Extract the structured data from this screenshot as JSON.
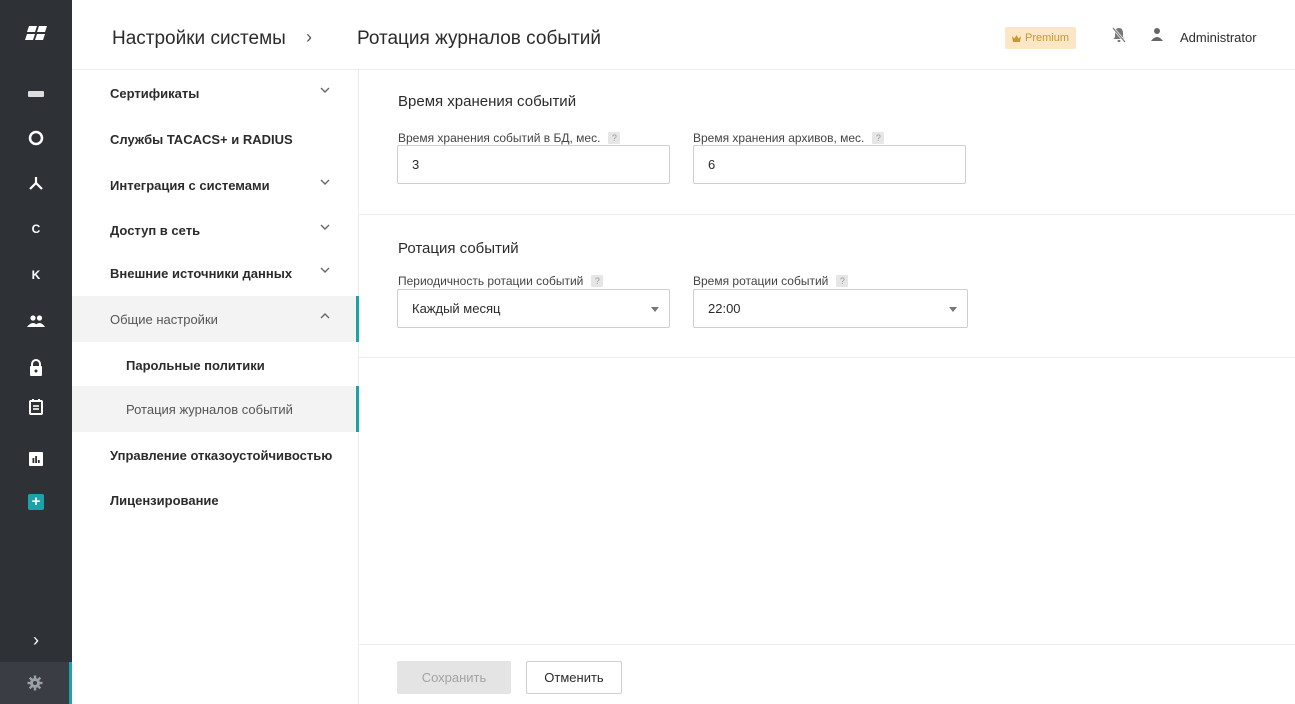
{
  "header": {
    "breadcrumb_root": "Настройки системы",
    "breadcrumb_sep": "›",
    "breadcrumb_current": "Ротация журналов событий",
    "premium_label": "Premium",
    "user_name": "Administrator"
  },
  "rail": {
    "items": [
      {
        "icon": "server-icon"
      },
      {
        "icon": "circle-icon"
      },
      {
        "icon": "network-icon"
      },
      {
        "icon": "letter-c-icon",
        "label": "C"
      },
      {
        "icon": "letter-k-icon",
        "label": "K"
      },
      {
        "icon": "users-icon"
      },
      {
        "icon": "lock-icon"
      },
      {
        "icon": "calendar-icon"
      },
      {
        "icon": "chart-icon"
      },
      {
        "icon": "plus-icon"
      },
      {
        "icon": "expand-icon",
        "label": "›"
      },
      {
        "icon": "gear-icon"
      }
    ]
  },
  "submenu": {
    "items": [
      {
        "label": "Сертификаты",
        "expandable": true
      },
      {
        "label": "Службы TACACS+ и RADIUS",
        "expandable": false
      },
      {
        "label": "Интеграция с системами",
        "expandable": true
      },
      {
        "label": "Доступ в сеть",
        "expandable": true
      },
      {
        "label": "Внешние источники данных",
        "expandable": true
      },
      {
        "label": "Общие настройки",
        "expandable": true,
        "expanded": true
      },
      {
        "label": "Парольные политики",
        "child": true
      },
      {
        "label": "Ротация журналов событий",
        "child": true,
        "active": true
      },
      {
        "label": "Управление отказоустойчивостью",
        "expandable": false
      },
      {
        "label": "Лицензирование",
        "expandable": false
      }
    ]
  },
  "retention": {
    "title": "Время хранения событий",
    "db_label": "Время хранения событий в БД, мес.",
    "db_value": "3",
    "archive_label": "Время хранения архивов, мес.",
    "archive_value": "6"
  },
  "rotation": {
    "title": "Ротация событий",
    "period_label": "Периодичность ротации событий",
    "period_value": "Каждый месяц",
    "time_label": "Время ротации событий",
    "time_value": "22:00"
  },
  "help_glyph": "?",
  "footer": {
    "save_label": "Сохранить",
    "cancel_label": "Отменить"
  },
  "colors": {
    "accent": "#1aa3a8",
    "rail_bg": "#2e3237",
    "premium_bg": "#fbe7c5",
    "premium_fg": "#c79a2d"
  }
}
